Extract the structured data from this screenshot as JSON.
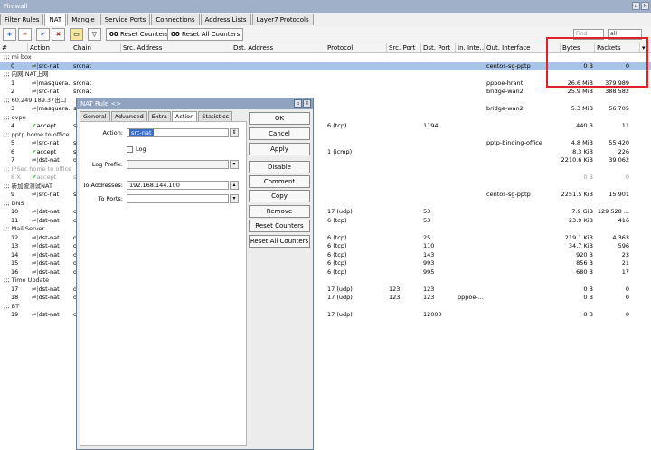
{
  "window": {
    "title": "Firewall"
  },
  "tabs": [
    "Filter Rules",
    "NAT",
    "Mangle",
    "Service Ports",
    "Connections",
    "Address Lists",
    "Layer7 Protocols"
  ],
  "toolbar": {
    "reset_counters": "Reset Counters",
    "reset_all_counters": "Reset All Counters",
    "find_placeholder": "Find",
    "filter_value": "all"
  },
  "columns": [
    "#",
    "Action",
    "Chain",
    "Src. Address",
    "Dst. Address",
    "Protocol",
    "Src. Port",
    "Dst. Port",
    "In. Inte...",
    "Out. Interface",
    "Bytes",
    "Packets"
  ],
  "rows": [
    {
      "type": "comment",
      "text": ";;; mi box"
    },
    {
      "type": "rule",
      "sel": true,
      "num": "0",
      "action": "src-nat",
      "chain": "srcnat",
      "proto": "",
      "sport": "",
      "dport": "",
      "inif": "",
      "outif": "centos-sg-pptp",
      "bytes": "0 B",
      "packets": "0"
    },
    {
      "type": "comment",
      "text": ";;; 内网 NAT上网"
    },
    {
      "type": "rule",
      "num": "1",
      "action": "masquera...",
      "chain": "srcnat",
      "proto": "",
      "sport": "",
      "dport": "",
      "inif": "",
      "outif": "pppoe-hrant",
      "bytes": "26.6 MiB",
      "packets": "379 989"
    },
    {
      "type": "rule",
      "num": "2",
      "action": "src-nat",
      "chain": "srcnat",
      "proto": "",
      "sport": "",
      "dport": "",
      "inif": "",
      "outif": "bridge-wan2",
      "bytes": "25.9 MiB",
      "packets": "388 582"
    },
    {
      "type": "comment",
      "text": ";;; 60.249.189.37出口"
    },
    {
      "type": "rule",
      "num": "3",
      "action": "masquera...",
      "chain": "s",
      "proto": "",
      "sport": "",
      "dport": "",
      "inif": "",
      "outif": "bridge-wan2",
      "bytes": "5.3 MiB",
      "packets": "56 705"
    },
    {
      "type": "comment",
      "text": ";;; ovpn"
    },
    {
      "type": "rule",
      "num": "4",
      "action": "accept",
      "icon": "ok",
      "chain": "s",
      "proto": "6 (tcp)",
      "sport": "",
      "dport": "1194",
      "inif": "",
      "outif": "",
      "bytes": "440 B",
      "packets": "11"
    },
    {
      "type": "comment",
      "text": ";;; pptp home to office"
    },
    {
      "type": "rule",
      "num": "5",
      "action": "src-nat",
      "chain": "s",
      "proto": "",
      "sport": "",
      "dport": "",
      "inif": "",
      "outif": "pptp-binding-office",
      "bytes": "4.8 MiB",
      "packets": "55 420"
    },
    {
      "type": "rule",
      "num": "6",
      "action": "accept",
      "icon": "ok",
      "chain": "s",
      "proto": "1 (icmp)",
      "sport": "",
      "dport": "",
      "inif": "",
      "outif": "",
      "bytes": "8.3 KiB",
      "packets": "226"
    },
    {
      "type": "rule",
      "num": "7",
      "action": "dst-nat",
      "chain": "d",
      "proto": "",
      "sport": "",
      "dport": "",
      "inif": "",
      "outif": "",
      "bytes": "2210.6 KiB",
      "packets": "39 062"
    },
    {
      "type": "comment",
      "disabled": true,
      "text": ";;; IPSec home to office"
    },
    {
      "type": "rule",
      "disabled": true,
      "num": "8 X",
      "action": "accept",
      "icon": "ok",
      "chain": "s",
      "proto": "",
      "sport": "",
      "dport": "",
      "inif": "",
      "outif": "",
      "bytes": "0 B",
      "packets": "0"
    },
    {
      "type": "comment",
      "text": ";;; 新加坡测试NAT"
    },
    {
      "type": "rule",
      "num": "9",
      "action": "src-nat",
      "chain": "s",
      "proto": "",
      "sport": "",
      "dport": "",
      "inif": "",
      "outif": "centos-sg-pptp",
      "bytes": "2251.5 KiB",
      "packets": "15 901"
    },
    {
      "type": "comment",
      "text": ";;; DNS"
    },
    {
      "type": "rule",
      "num": "10",
      "action": "dst-nat",
      "chain": "d",
      "proto": "17 (udp)",
      "sport": "",
      "dport": "53",
      "inif": "",
      "outif": "",
      "bytes": "7.9 GiB",
      "packets": "129 528 ..."
    },
    {
      "type": "rule",
      "num": "11",
      "action": "dst-nat",
      "chain": "d",
      "proto": "6 (tcp)",
      "sport": "",
      "dport": "53",
      "inif": "",
      "outif": "",
      "bytes": "23.9 KiB",
      "packets": "416"
    },
    {
      "type": "comment",
      "text": ";;; Mail Server"
    },
    {
      "type": "rule",
      "num": "12",
      "action": "dst-nat",
      "chain": "d",
      "proto": "6 (tcp)",
      "sport": "",
      "dport": "25",
      "inif": "",
      "outif": "",
      "bytes": "219.1 KiB",
      "packets": "4 363"
    },
    {
      "type": "rule",
      "num": "13",
      "action": "dst-nat",
      "chain": "d",
      "proto": "6 (tcp)",
      "sport": "",
      "dport": "110",
      "inif": "",
      "outif": "",
      "bytes": "34.7 KiB",
      "packets": "596"
    },
    {
      "type": "rule",
      "num": "14",
      "action": "dst-nat",
      "chain": "d",
      "proto": "6 (tcp)",
      "sport": "",
      "dport": "143",
      "inif": "",
      "outif": "",
      "bytes": "920 B",
      "packets": "23"
    },
    {
      "type": "rule",
      "num": "15",
      "action": "dst-nat",
      "chain": "d",
      "proto": "6 (tcp)",
      "sport": "",
      "dport": "993",
      "inif": "",
      "outif": "",
      "bytes": "856 B",
      "packets": "21"
    },
    {
      "type": "rule",
      "num": "16",
      "action": "dst-nat",
      "chain": "d",
      "proto": "6 (tcp)",
      "sport": "",
      "dport": "995",
      "inif": "",
      "outif": "",
      "bytes": "680 B",
      "packets": "17"
    },
    {
      "type": "comment",
      "text": ";;; Time Update"
    },
    {
      "type": "rule",
      "num": "17",
      "action": "dst-nat",
      "chain": "d",
      "proto": "17 (udp)",
      "sport": "123",
      "dport": "123",
      "inif": "",
      "outif": "",
      "bytes": "0 B",
      "packets": "0"
    },
    {
      "type": "rule",
      "num": "18",
      "action": "dst-nat",
      "chain": "d",
      "proto": "17 (udp)",
      "sport": "123",
      "dport": "123",
      "inif": "pppoe-...",
      "outif": "",
      "bytes": "0 B",
      "packets": "0"
    },
    {
      "type": "comment",
      "text": ";;; BT"
    },
    {
      "type": "rule",
      "num": "19",
      "action": "dst-nat",
      "chain": "d",
      "proto": "17 (udp)",
      "sport": "",
      "dport": "12000",
      "inif": "",
      "outif": "",
      "bytes": "0 B",
      "packets": "0"
    }
  ],
  "dialog": {
    "title": "NAT Rule <>",
    "tabs": [
      "General",
      "Advanced",
      "Extra",
      "Action",
      "Statistics"
    ],
    "action_label": "Action:",
    "action_value": "src-nat",
    "log_label": "Log",
    "log_prefix_label": "Log Prefix:",
    "to_addresses_label": "To Addresses:",
    "to_addresses_value": "192.168.144.100",
    "to_ports_label": "To Ports:",
    "buttons": [
      "OK",
      "Cancel",
      "Apply",
      "Disable",
      "Comment",
      "Copy",
      "Remove",
      "Reset Counters",
      "Reset All Counters"
    ]
  },
  "colors": {
    "selection": "#a8c4e8",
    "highlight_box": "#e0202a",
    "dialog_title": "#8fa3c1"
  }
}
